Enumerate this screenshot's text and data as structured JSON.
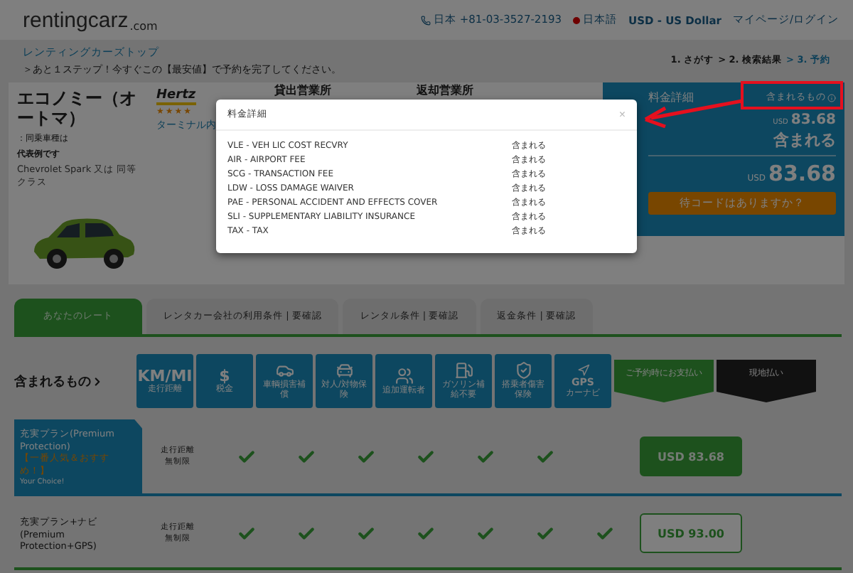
{
  "header": {
    "logo": "rentingcarz",
    "logo_suffix": ".com",
    "phone": "日本 +81-03-3527-2193",
    "language": "日本語",
    "currency": "USD - US Dollar",
    "account": "マイページ/ログイン"
  },
  "breadcrumb": {
    "link": "レンティングカーズトップ",
    "message": "＞あと１ステップ！今すぐこの【最安値】で予約を完了してください。",
    "steps": [
      {
        "label": "1. さがす",
        "selected": false
      },
      {
        "label": "> 2. 検索結果",
        "selected": false
      },
      {
        "label": "> 3. 予約",
        "selected": true
      }
    ]
  },
  "car": {
    "title": "エコノミー（オートマ）",
    "similar_label": "：同乗車種は",
    "example_label": "代表例です",
    "model": "Chevrolet Spark 又は 同等クラス",
    "supplier": "Hertz",
    "stars": 4,
    "location": "ターミナル内",
    "pickup_heading": "貸出営業所",
    "return_heading": "返却営業所"
  },
  "price_panel": {
    "heading": "料金詳細",
    "included_link": "含まれるもの",
    "amount_currency": "USD",
    "amount": "83.68",
    "included_value": "含まれる",
    "total_currency": "USD",
    "total": "83.68",
    "coupon_button": "待コードはありますか？"
  },
  "tabs": [
    {
      "label": "あなたのレート",
      "selected": true
    },
    {
      "label": "レンタカー会社の利用条件 | 要確認",
      "selected": false
    },
    {
      "label": "レンタル条件 | 要確認",
      "selected": false
    },
    {
      "label": "返金条件 | 要確認",
      "selected": false
    }
  ],
  "included": {
    "heading": "含まれるもの",
    "features": [
      {
        "kind": "text",
        "symbol": "KM/MI",
        "label": "走行距離"
      },
      {
        "kind": "text",
        "symbol": "$",
        "label": "税金"
      },
      {
        "kind": "damage",
        "label": "車輌損害補償"
      },
      {
        "kind": "liability",
        "label": "対人/対物保険"
      },
      {
        "kind": "driver",
        "label": "追加運転者"
      },
      {
        "kind": "fuel",
        "label": "ガソリン補給不要"
      },
      {
        "kind": "injury",
        "label": "搭乗者傷害保険"
      },
      {
        "kind": "gps",
        "symbol": "GPS",
        "label": "カーナビ"
      }
    ],
    "pay_now": "ご予約時にお支払い",
    "pay_later": "現地払い"
  },
  "plans": [
    {
      "name": "充実プラン(Premium Protection)",
      "badge": "【一番人気＆おすすめ！】",
      "choice": "Your Choice!",
      "selected": true,
      "mileage": "走行距離無制限",
      "checks": [
        true,
        true,
        true,
        true,
        true,
        true,
        false
      ],
      "price": "USD 83.68"
    },
    {
      "name": "充実プラン+ナビ (Premium Protection+GPS)",
      "selected": false,
      "mileage": "走行距離無制限",
      "checks": [
        true,
        true,
        true,
        true,
        true,
        true,
        true
      ],
      "price": "USD 93.00"
    }
  ],
  "modal": {
    "title": "料金詳細",
    "close": "×",
    "rows": [
      {
        "name": "VLE - VEH LIC COST RECVRY",
        "value": "含まれる"
      },
      {
        "name": "AIR - AIRPORT FEE",
        "value": "含まれる"
      },
      {
        "name": "SCG - TRANSACTION FEE",
        "value": "含まれる"
      },
      {
        "name": "LDW - LOSS DAMAGE WAIVER",
        "value": "含まれる"
      },
      {
        "name": "PAE - PERSONAL ACCIDENT AND EFFECTS COVER",
        "value": "含まれる"
      },
      {
        "name": "SLI - SUPPLEMENTARY LIABILITY INSURANCE",
        "value": "含まれる"
      },
      {
        "name": "TAX - TAX",
        "value": "含まれる"
      }
    ]
  }
}
